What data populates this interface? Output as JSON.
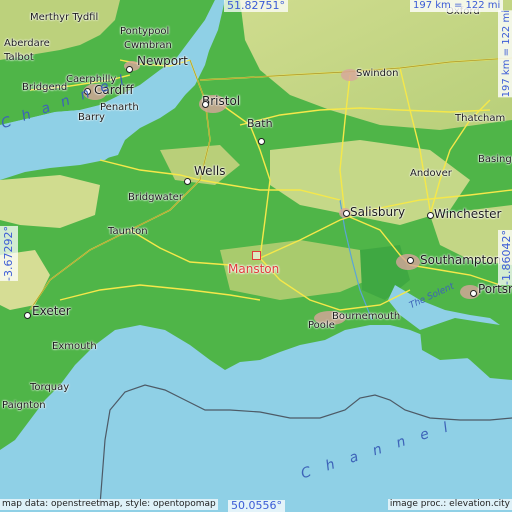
{
  "colors": {
    "sea": "#8fd0e6",
    "lowland": "#4fb548",
    "upland": "#c9d98a",
    "road": "#f5e84a",
    "marker": "#e23b3b",
    "coord_text": "#3b5bd6"
  },
  "coords": {
    "top": "51.82751°",
    "bottom": "50.0556°",
    "left": "-3.67292°",
    "right": "-1.86042°"
  },
  "scale": {
    "top": "197 km = 122 mi",
    "right": "197 km = 122 mi"
  },
  "marker": {
    "name": "Manston"
  },
  "places": [
    {
      "id": "merthyr",
      "name": "Merthyr Tydfil"
    },
    {
      "id": "aberdare",
      "name": "Aberdare"
    },
    {
      "id": "pontypool",
      "name": "Pontypool"
    },
    {
      "id": "cwmbran",
      "name": "Cwmbran"
    },
    {
      "id": "talbot",
      "name": "Talbot"
    },
    {
      "id": "newport",
      "name": "Newport"
    },
    {
      "id": "caerphilly",
      "name": "Caerphilly"
    },
    {
      "id": "bridgend",
      "name": "Bridgend"
    },
    {
      "id": "cardiff",
      "name": "Cardiff"
    },
    {
      "id": "penarth",
      "name": "Penarth"
    },
    {
      "id": "barry",
      "name": "Barry"
    },
    {
      "id": "bristol",
      "name": "Bristol"
    },
    {
      "id": "swindon",
      "name": "Swindon"
    },
    {
      "id": "oxford",
      "name": "Oxford"
    },
    {
      "id": "bath",
      "name": "Bath"
    },
    {
      "id": "thatcham",
      "name": "Thatcham"
    },
    {
      "id": "wells",
      "name": "Wells"
    },
    {
      "id": "basings",
      "name": "Basings"
    },
    {
      "id": "andover",
      "name": "Andover"
    },
    {
      "id": "bridgwater",
      "name": "Bridgwater"
    },
    {
      "id": "salisbury",
      "name": "Salisbury"
    },
    {
      "id": "winchester",
      "name": "Winchester"
    },
    {
      "id": "taunton",
      "name": "Taunton"
    },
    {
      "id": "southampton",
      "name": "Southampton"
    },
    {
      "id": "portsm",
      "name": "Portsm"
    },
    {
      "id": "exeter",
      "name": "Exeter"
    },
    {
      "id": "bournemouth",
      "name": "Bournemouth"
    },
    {
      "id": "poole",
      "name": "Poole"
    },
    {
      "id": "exmouth",
      "name": "Exmouth"
    },
    {
      "id": "torquay",
      "name": "Torquay"
    },
    {
      "id": "paignton",
      "name": "Paignton"
    }
  ],
  "water_labels": {
    "channel_west": "Channel",
    "solent": "The Solent",
    "channel_south": "Channel"
  },
  "credits": {
    "left": "map data: openstreetmap, style: opentopomap",
    "right": "image proc.: elevation.city"
  }
}
